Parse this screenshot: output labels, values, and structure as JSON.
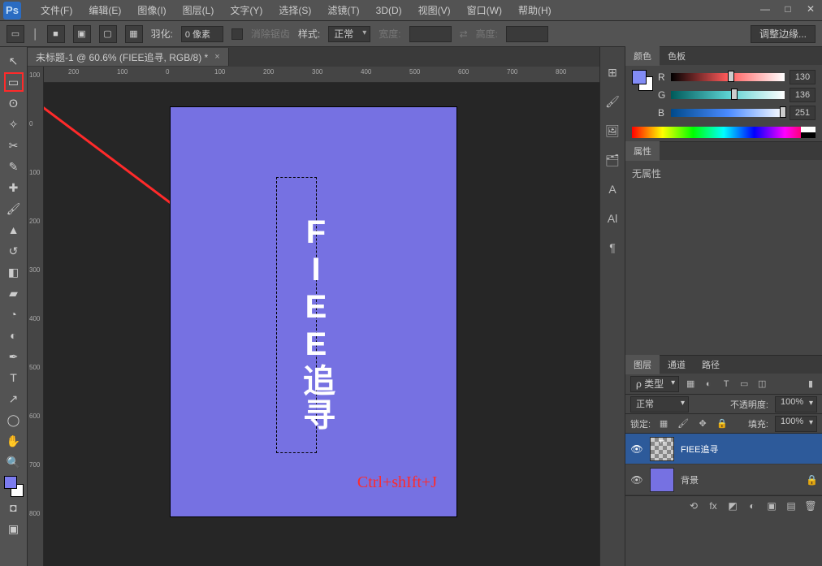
{
  "app_logo": "Ps",
  "menus": [
    "文件(F)",
    "编辑(E)",
    "图像(I)",
    "图层(L)",
    "文字(Y)",
    "选择(S)",
    "滤镜(T)",
    "3D(D)",
    "视图(V)",
    "窗口(W)",
    "帮助(H)"
  ],
  "options_bar": {
    "feather_label": "羽化:",
    "feather_value": "0 像素",
    "antialias_label": "消除锯齿",
    "style_label": "样式:",
    "style_value": "正常",
    "width_label": "宽度:",
    "height_label": "高度:",
    "refine_edge": "调整边缘..."
  },
  "document_tab": {
    "title": "未标题-1 @ 60.6% (FIEE追寻, RGB/8) *",
    "close": "×"
  },
  "rulers": {
    "h_ticks": [
      "100",
      "200",
      "100",
      "0",
      "100",
      "200",
      "300",
      "400",
      "500",
      "600",
      "700",
      "800"
    ],
    "v_ticks": [
      "100",
      "0",
      "100",
      "200",
      "300",
      "400",
      "500",
      "600",
      "700",
      "800"
    ]
  },
  "canvas": {
    "vertical_text": "FIEE追寻",
    "shortcut_text": "Ctrl+shIft+J"
  },
  "color_panel": {
    "tab_color": "颜色",
    "tab_swatches": "色板",
    "channels": [
      {
        "name": "R",
        "value": "130",
        "knob": 60
      },
      {
        "name": "G",
        "value": "136",
        "knob": 63
      },
      {
        "name": "B",
        "value": "251",
        "knob": 96
      }
    ]
  },
  "properties_panel": {
    "tab": "属性",
    "body": "无属性"
  },
  "layers_panel": {
    "tabs": [
      "图层",
      "通道",
      "路径"
    ],
    "kind_label": "ρ 类型",
    "blend_value": "正常",
    "opacity_label": "不透明度:",
    "opacity_value": "100%",
    "lock_label": "锁定:",
    "fill_label": "填充:",
    "fill_value": "100%",
    "layers": [
      {
        "name": "FIEE追寻",
        "active": true,
        "checker": true
      },
      {
        "name": "背景",
        "active": false,
        "checker": false
      }
    ]
  },
  "tools": [
    "move",
    "marquee",
    "lasso",
    "crop",
    "eyedropper",
    "heal",
    "brush",
    "clone",
    "history",
    "eraser",
    "gradient",
    "blur",
    "dodge",
    "pen",
    "type",
    "path-select",
    "shape",
    "hand",
    "zoom"
  ],
  "side_tabs": [
    "⊞",
    "🖌",
    "🖼",
    "🗂",
    "A",
    "Al",
    "¶"
  ]
}
